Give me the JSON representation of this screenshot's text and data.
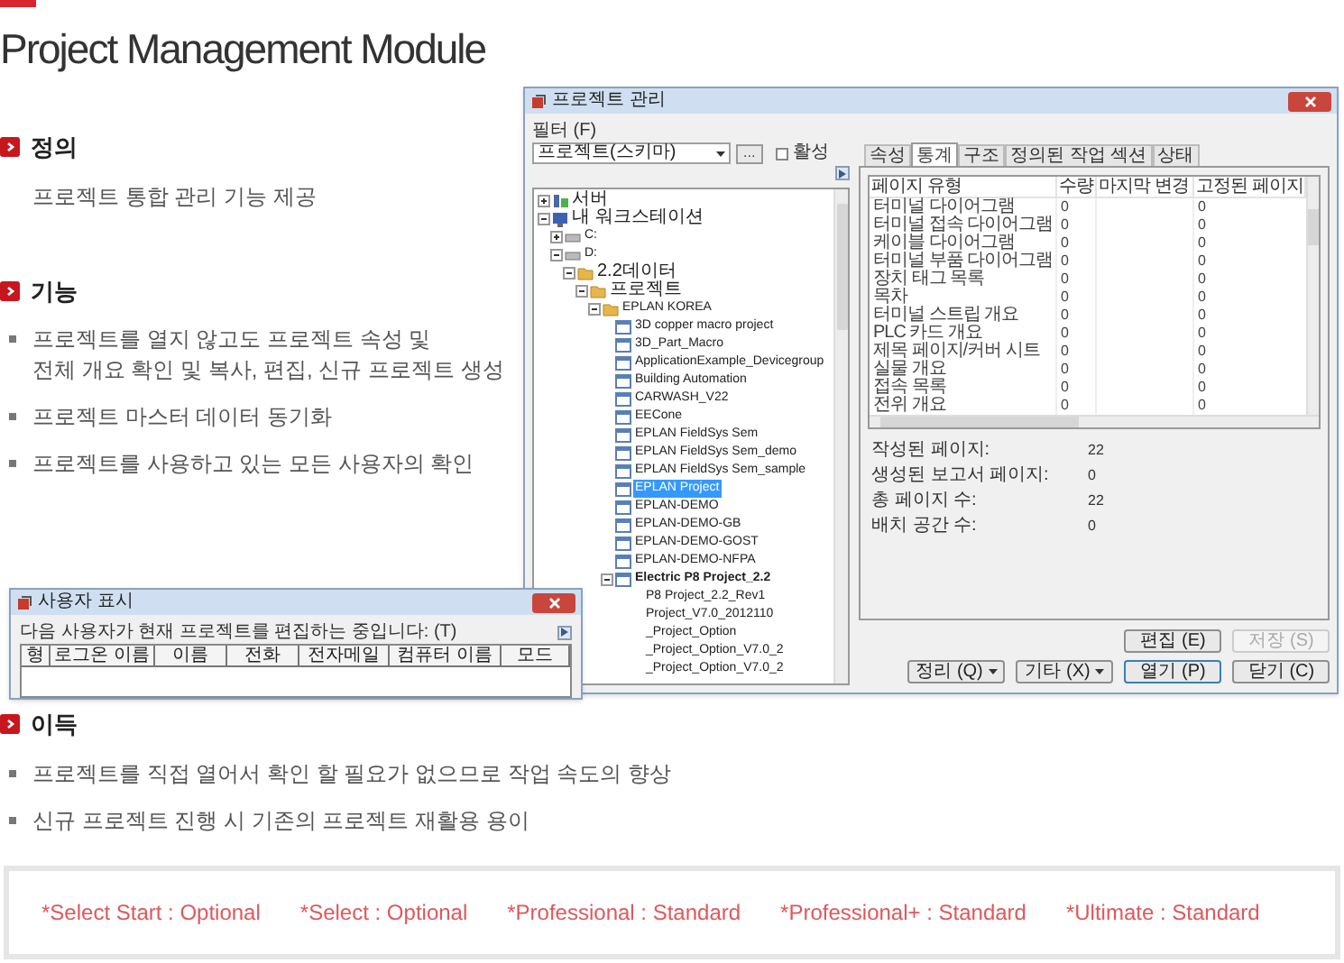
{
  "page_title": "Project Management Module",
  "sections": [
    {
      "heading": "정의",
      "items": [
        {
          "kind": "text",
          "lines": [
            "프로젝트 통합 관리 기능 제공"
          ]
        }
      ]
    },
    {
      "heading": "기능",
      "items": [
        {
          "kind": "bullet",
          "lines": [
            "프로젝트를 열지 않고도 프로젝트 속성 및",
            "전체 개요 확인 및 복사, 편집, 신규 프로젝트 생성"
          ]
        },
        {
          "kind": "bullet",
          "lines": [
            "프로젝트 마스터 데이터 동기화"
          ]
        },
        {
          "kind": "bullet",
          "lines": [
            "프로젝트를 사용하고 있는 모든 사용자의 확인"
          ]
        }
      ]
    }
  ],
  "window": {
    "title": "프로젝트 관리",
    "filter": {
      "label": "필터 (F)",
      "value": "프로젝트(스키마)",
      "browse": "...",
      "active_label": "활성",
      "active_checked": false
    },
    "tree": [
      {
        "label": "서버",
        "kind": "server",
        "expanded": false,
        "selected": false,
        "current": false
      },
      {
        "label": "내 워크스테이션",
        "kind": "workstation",
        "expanded": true,
        "selected": false,
        "current": false,
        "children": [
          {
            "label": "C:",
            "kind": "drive",
            "expanded": false,
            "selected": false,
            "current": false
          },
          {
            "label": "D:",
            "kind": "drive",
            "expanded": true,
            "selected": false,
            "current": false,
            "children": [
              {
                "label": "2.2데이터",
                "kind": "folder",
                "expanded": true,
                "selected": false,
                "current": false,
                "children": [
                  {
                    "label": "프로젝트",
                    "kind": "folder",
                    "expanded": true,
                    "selected": false,
                    "current": false,
                    "children": [
                      {
                        "label": "EPLAN KOREA",
                        "kind": "folder",
                        "expanded": true,
                        "selected": false,
                        "current": false,
                        "children": [
                          {
                            "label": "3D copper macro project",
                            "kind": "project",
                            "selected": false,
                            "current": false
                          },
                          {
                            "label": "3D_Part_Macro",
                            "kind": "project",
                            "selected": false,
                            "current": false
                          },
                          {
                            "label": "ApplicationExample_Devicegroup",
                            "kind": "project",
                            "selected": false,
                            "current": false
                          },
                          {
                            "label": "Building Automation",
                            "kind": "project",
                            "selected": false,
                            "current": false
                          },
                          {
                            "label": "CARWASH_V22",
                            "kind": "project",
                            "selected": false,
                            "current": false
                          },
                          {
                            "label": "EECone",
                            "kind": "project",
                            "selected": false,
                            "current": false
                          },
                          {
                            "label": "EPLAN FieldSys Sem",
                            "kind": "project",
                            "selected": false,
                            "current": false
                          },
                          {
                            "label": "EPLAN FieldSys Sem_demo",
                            "kind": "project",
                            "selected": false,
                            "current": false
                          },
                          {
                            "label": "EPLAN FieldSys Sem_sample",
                            "kind": "project",
                            "selected": false,
                            "current": false
                          },
                          {
                            "label": "EPLAN Project",
                            "kind": "project",
                            "selected": true,
                            "current": false
                          },
                          {
                            "label": "EPLAN-DEMO",
                            "kind": "project",
                            "selected": false,
                            "current": false
                          },
                          {
                            "label": "EPLAN-DEMO-GB",
                            "kind": "project",
                            "selected": false,
                            "current": false
                          },
                          {
                            "label": "EPLAN-DEMO-GOST",
                            "kind": "project",
                            "selected": false,
                            "current": false
                          },
                          {
                            "label": "EPLAN-DEMO-NFPA",
                            "kind": "project",
                            "selected": false,
                            "current": false
                          },
                          {
                            "label": "Electric P8 Project_2.2",
                            "kind": "project",
                            "expanded": true,
                            "selected": false,
                            "current": true,
                            "children": [
                              {
                                "label": "P8 Project_2.2_Rev1",
                                "selected": false,
                                "current": false
                              },
                              {
                                "label": "Project_V7.0_2012110",
                                "selected": false,
                                "current": false
                              },
                              {
                                "label": "_Project_Option",
                                "selected": false,
                                "current": false
                              },
                              {
                                "label": "_Project_Option_V7.0_2",
                                "selected": false,
                                "current": false
                              },
                              {
                                "label": "_Project_Option_V7.0_2",
                                "selected": false,
                                "current": false
                              }
                            ]
                          }
                        ]
                      }
                    ]
                  }
                ]
              }
            ]
          }
        ]
      }
    ],
    "tabs": [
      {
        "label": "속성",
        "selected": false
      },
      {
        "label": "통계",
        "selected": true
      },
      {
        "label": "구조",
        "selected": false
      },
      {
        "label": "정의된 작업 섹션",
        "selected": false
      },
      {
        "label": "상태",
        "selected": false
      }
    ],
    "table": {
      "columns": [
        "페이지 유형",
        "수량",
        "마지막 변경",
        "고정된 페이지"
      ],
      "rows": [
        {
          "page_type": "터미널 다이어그램",
          "count": "0",
          "fixed": "0"
        },
        {
          "page_type": "터미널 접속 다이어그램",
          "count": "0",
          "fixed": "0"
        },
        {
          "page_type": "케이블 다이어그램",
          "count": "0",
          "fixed": "0"
        },
        {
          "page_type": "터미널 부품 다이어그램",
          "count": "0",
          "fixed": "0"
        },
        {
          "page_type": "장치 태그 목록",
          "count": "0",
          "fixed": "0"
        },
        {
          "page_type": "목차",
          "count": "0",
          "fixed": "0"
        },
        {
          "page_type": "터미널 스트립 개요",
          "count": "0",
          "fixed": "0"
        },
        {
          "page_type": "PLC 카드 개요",
          "count": "0",
          "fixed": "0"
        },
        {
          "page_type": "제목 페이지/커버 시트",
          "count": "0",
          "fixed": "0"
        },
        {
          "page_type": "실물 개요",
          "count": "0",
          "fixed": "0"
        },
        {
          "page_type": "접속 목록",
          "count": "0",
          "fixed": "0"
        },
        {
          "page_type": "전위 개요",
          "count": "0",
          "fixed": "0"
        }
      ]
    },
    "stats": [
      {
        "label": "작성된 페이지:",
        "value": "22"
      },
      {
        "label": "생성된 보고서 페이지:",
        "value": "0"
      },
      {
        "label": "총 페이지 수:",
        "value": "22"
      },
      {
        "label": "배치 공간 수:",
        "value": "0"
      }
    ],
    "button_rows": [
      [
        {
          "label": "편집 (E)",
          "kind": "plain",
          "disabled": false,
          "focused": false
        },
        {
          "label": "저장 (S)",
          "kind": "plain",
          "disabled": true,
          "focused": false
        }
      ],
      [
        {
          "label": "정리 (Q)",
          "kind": "menu",
          "disabled": false,
          "focused": false
        },
        {
          "label": "기타 (X)",
          "kind": "menu",
          "disabled": false,
          "focused": false
        },
        {
          "label": "열기 (P)",
          "kind": "plain",
          "disabled": false,
          "focused": true
        },
        {
          "label": "닫기 (C)",
          "kind": "plain",
          "disabled": false,
          "focused": false
        }
      ]
    ]
  },
  "user_dialog": {
    "title": "사용자 표시",
    "message": "다음 사용자가 현재 프로젝트를 편집하는 중입니다: (T)",
    "columns": [
      "형",
      "로그온 이름",
      "이름",
      "전화",
      "전자메일",
      "컴퓨터 이름",
      "모드"
    ]
  },
  "benefits": {
    "heading": "이득",
    "items": [
      "프로젝트를 직접 열어서 확인 할 필요가 없으므로 작업 속도의 향상",
      "신규 프로젝트 진행 시 기존의 프로젝트 재활용 용이"
    ]
  },
  "editions": [
    "*Select Start : Optional",
    "*Select : Optional",
    "*Professional : Standard",
    "*Professional+ : Standard",
    "*Ultimate : Standard"
  ]
}
